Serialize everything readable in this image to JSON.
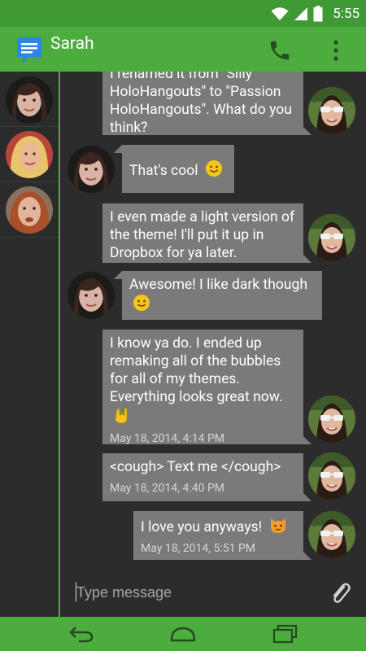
{
  "status_bar": {
    "time": "5:55",
    "icons": [
      "wifi-icon",
      "signal-icon",
      "battery-icon"
    ]
  },
  "app_bar": {
    "title": "Sarah",
    "icons": [
      "messages-logo-icon",
      "phone-icon",
      "overflow-menu-icon"
    ]
  },
  "colors": {
    "accent": "#4cac3e",
    "status": "#3f9a35",
    "bubble": "#7a7a7a",
    "background": "#2c2c2c"
  },
  "sidebar": {
    "contacts": [
      "contact-avatar-brunette",
      "contact-avatar-blonde",
      "contact-avatar-redhead"
    ]
  },
  "messages": [
    {
      "sender": "me",
      "text": "I renamed it from \"Silly HoloHangouts\" to \"Passion HoloHangouts\". What do you think?"
    },
    {
      "sender": "them",
      "text": "That's cool",
      "emoji": "smiley-icon"
    },
    {
      "sender": "me",
      "text": "I even made a light version of the theme! I'll put it up in Dropbox for ya later."
    },
    {
      "sender": "them",
      "text": "Awesome! I like dark though",
      "emoji": "smiley-icon"
    },
    {
      "sender": "me",
      "text": "I know ya do. I ended up remaking all of the bubbles for all of my themes. Everything looks great now.",
      "emoji": "rock-hand-icon",
      "timestamp": "May 18, 2014, 4:14 PM"
    },
    {
      "sender": "me",
      "text": "<cough> Text me </cough>",
      "timestamp": "May 18, 2014, 4:40 PM"
    },
    {
      "sender": "me",
      "text": "I love you anyways!",
      "emoji": "cat-face-icon",
      "timestamp": "May 18, 2014, 5:51 PM"
    }
  ],
  "composer": {
    "placeholder": "Type message",
    "icons": [
      "attach-icon"
    ]
  },
  "nav_bar": {
    "icons": [
      "back-icon",
      "home-icon",
      "recents-icon"
    ]
  }
}
